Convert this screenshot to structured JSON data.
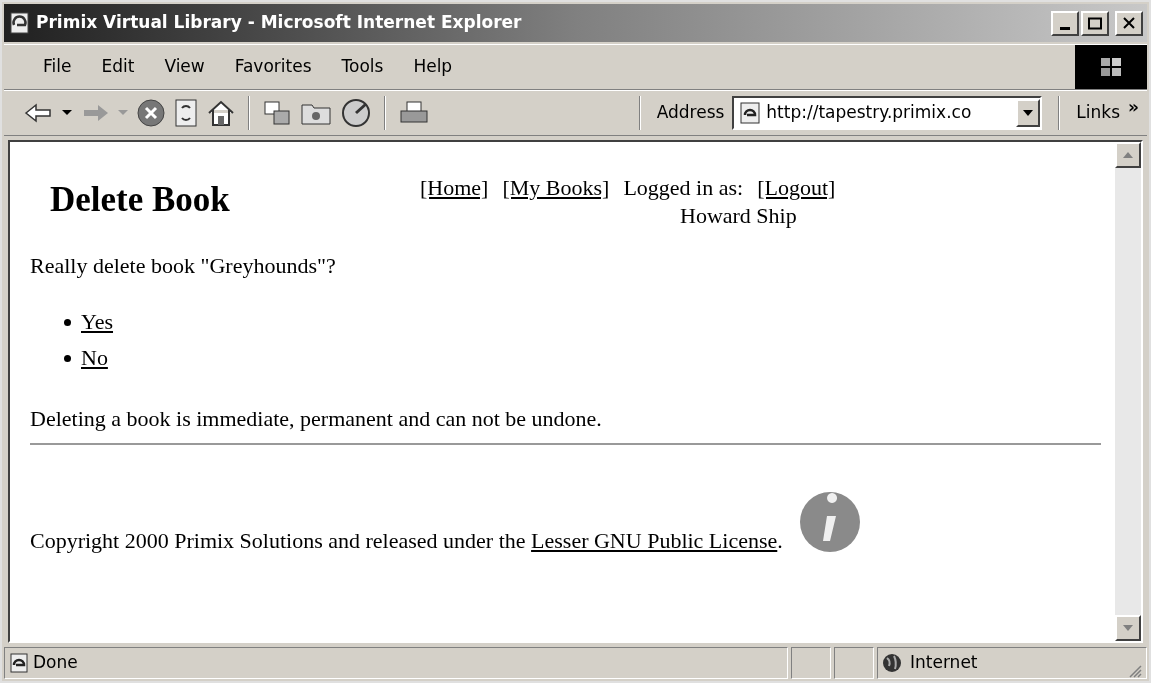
{
  "window": {
    "title": "Primix Virtual Library - Microsoft Internet Explorer"
  },
  "menu": [
    "File",
    "Edit",
    "View",
    "Favorites",
    "Tools",
    "Help"
  ],
  "address_bar": {
    "label": "Address",
    "value": "http://tapestry.primix.co",
    "links": "Links",
    "more": "»"
  },
  "page": {
    "heading": "Delete Book",
    "nav": [
      {
        "label": "[Home]",
        "kind": "link"
      },
      {
        "label": "[My Books]",
        "kind": "link"
      },
      {
        "label": "Logged in as:",
        "kind": "text"
      },
      {
        "label": "[Logout]",
        "kind": "link"
      }
    ],
    "user": "Howard Ship",
    "question": "Really delete book \"Greyhounds\"?",
    "options": [
      "Yes",
      "No"
    ],
    "warning": "Deleting a book is immediate, permanent and can not be undone.",
    "footer": {
      "text": "Copyright 2000 Primix Solutions and released under the ",
      "link": "Lesser GNU Public License",
      "after": "."
    }
  },
  "status_bar": {
    "text": "Done",
    "zone": "Internet"
  }
}
